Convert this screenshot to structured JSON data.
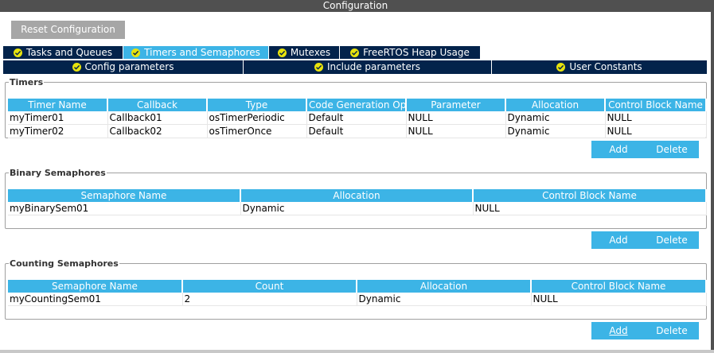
{
  "window": {
    "title": "Configuration"
  },
  "reset_label": "Reset Configuration",
  "tabs": [
    {
      "label": "Tasks and Queues"
    },
    {
      "label": "Timers and Semaphores"
    },
    {
      "label": "Mutexes"
    },
    {
      "label": "FreeRTOS Heap Usage"
    }
  ],
  "subtabs": [
    {
      "label": "Config parameters"
    },
    {
      "label": "Include parameters"
    },
    {
      "label": "User Constants"
    }
  ],
  "timers": {
    "title": "Timers",
    "columns": [
      "Timer Name",
      "Callback",
      "Type",
      "Code Generation Op...",
      "Parameter",
      "Allocation",
      "Control Block Name"
    ],
    "rows": [
      [
        "myTimer01",
        "Callback01",
        "osTimerPeriodic",
        "Default",
        "NULL",
        "Dynamic",
        "NULL"
      ],
      [
        "myTimer02",
        "Callback02",
        "osTimerOnce",
        "Default",
        "NULL",
        "Dynamic",
        "NULL"
      ]
    ],
    "add_label": "Add",
    "delete_label": "Delete"
  },
  "binary": {
    "title": "Binary Semaphores",
    "columns": [
      "Semaphore Name",
      "Allocation",
      "Control Block Name"
    ],
    "rows": [
      [
        "myBinarySem01",
        "Dynamic",
        "NULL"
      ]
    ],
    "add_label": "Add",
    "delete_label": "Delete"
  },
  "counting": {
    "title": "Counting Semaphores",
    "columns": [
      "Semaphore Name",
      "Count",
      "Allocation",
      "Control Block Name"
    ],
    "rows": [
      [
        "myCountingSem01",
        "2",
        "Dynamic",
        "NULL"
      ]
    ],
    "add_label": "Add",
    "delete_label": "Delete"
  },
  "colors": {
    "title_bar": "#505050",
    "tab_dark": "#03234b",
    "accent": "#3cb4e6",
    "check": "#e8e30d"
  }
}
